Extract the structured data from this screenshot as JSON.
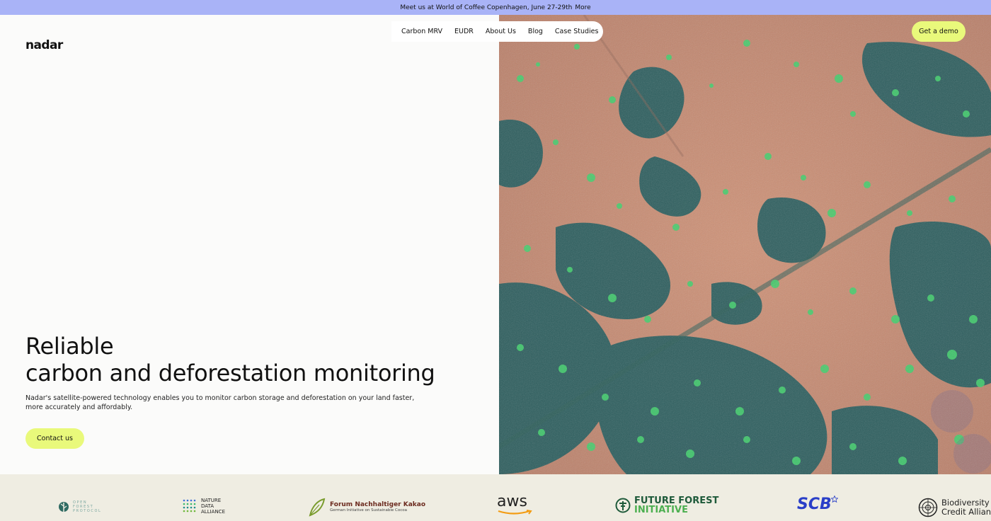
{
  "announcement": {
    "text": "Meet us at World of Coffee Copenhagen, June 27-29th",
    "link": "More"
  },
  "brand": {
    "logo": "nadar"
  },
  "nav": {
    "items": [
      "Carbon MRV",
      "EUDR",
      "About Us",
      "Blog",
      "Case Studies"
    ]
  },
  "cta": {
    "demo": "Get a demo",
    "contact": "Contact us"
  },
  "hero": {
    "title_line1": "Reliable",
    "title_line2": "carbon and deforestation monitoring",
    "subtitle": "Nadar's satellite-powered technology enables you to monitor carbon storage and deforestation on your land faster, more accurately and affordably."
  },
  "partners": {
    "ofp": [
      "OPEN",
      "FOREST",
      "PROTOCOL"
    ],
    "nda": [
      "NATURE",
      "DATA",
      "ALLIANCE"
    ],
    "fnk": {
      "name": "Forum Nachhaltiger Kakao",
      "tagline": "German Initiative on Sustainable Cocoa"
    },
    "aws": "aws",
    "ffi": [
      "FUTURE FOREST",
      "INITIATIVE"
    ],
    "scb": "SCB",
    "bca": [
      "Biodiversity",
      "Credit Alliance"
    ]
  },
  "colors": {
    "announce_bg": "#a9b3f7",
    "accent": "#e9f97b",
    "logo_strip_bg": "#efede2"
  },
  "icons": [
    "ofp-leaf-icon",
    "nda-dots-icon",
    "fnk-leaf-icon",
    "aws-smile-icon",
    "ffi-tree-icon",
    "scb-star-icon",
    "bca-globe-icon"
  ]
}
